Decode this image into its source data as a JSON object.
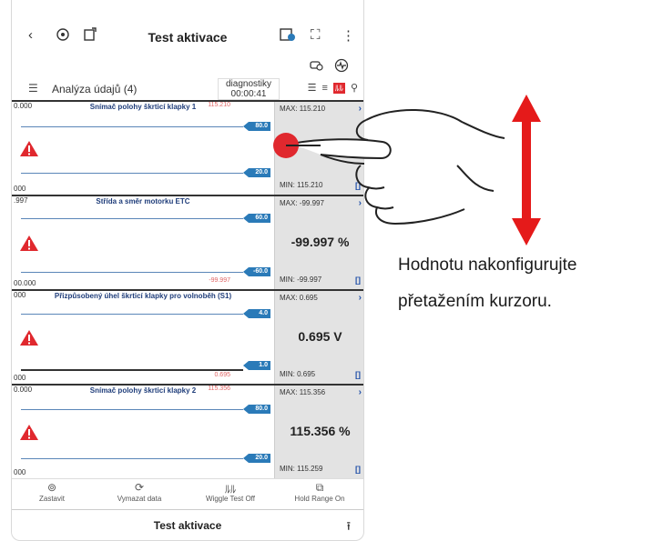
{
  "topbar": {
    "back_icon": "chevron-left-icon",
    "title": "Test aktivace"
  },
  "header": {
    "label": "Analýza údajů (4)",
    "diag_label": "diagnostiky",
    "diag_time": "00:00:41"
  },
  "panels": [
    {
      "title": "Snímač polohy škrticí klapky 1",
      "axis_top": "0.000",
      "axis_bottom": "000",
      "red_top": "115.210",
      "red_bottom": "",
      "tag_top": "80.0",
      "tag_bottom": "20.0",
      "max": "MAX: 115.210",
      "min": "MIN: 115.210",
      "value": "",
      "chevron": "›",
      "bracket": "[]"
    },
    {
      "title": "Střída a směr motorku ETC",
      "axis_top": ".997",
      "axis_bottom": "00.000",
      "red_top": "",
      "red_bottom": "-99.997",
      "tag_top": "60.0",
      "tag_bottom": "-60.0",
      "max": "MAX: -99.997",
      "min": "MIN: -99.997",
      "value": "-99.997 %",
      "chevron": "›",
      "bracket": "[]"
    },
    {
      "title": "Přizpůsobený úhel škrticí klapky pro volnoběh (S1)",
      "axis_top": "000",
      "axis_bottom": "000",
      "red_top": "",
      "red_bottom": "0.695",
      "tag_top": "4.0",
      "tag_bottom": "1.0",
      "max": "MAX: 0.695",
      "min": "MIN: 0.695",
      "value": "0.695 V",
      "chevron": "›",
      "bracket": "[]"
    },
    {
      "title": "Snímač polohy škrticí klapky 2",
      "axis_top": "0.000",
      "axis_bottom": "000",
      "red_top": "115.356",
      "red_bottom": "",
      "tag_top": "80.0",
      "tag_bottom": "20.0",
      "max": "MAX: 115.356",
      "min": "MIN: 115.259",
      "value": "115.356 %",
      "chevron": "›",
      "bracket": "[]"
    }
  ],
  "toolbar": {
    "stop": "Zastavit",
    "clear": "Vymazat data",
    "wiggle": "Wiggle Test Off",
    "hold": "Hold Range On"
  },
  "footer": {
    "title": "Test aktivace"
  },
  "caption": {
    "line1": "Hodnotu nakonfigurujte",
    "line2": "přetažením kurzoru."
  },
  "colors": {
    "accent_blue": "#2a7ab8",
    "warning_red": "#e0282e",
    "arrow_red": "#e51a1a"
  }
}
